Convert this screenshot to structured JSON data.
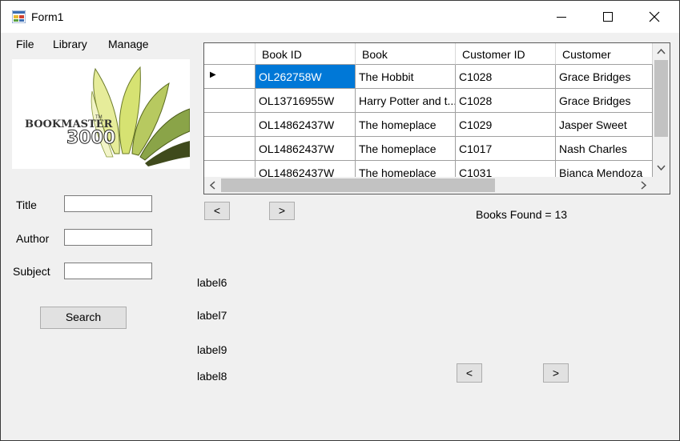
{
  "window": {
    "title": "Form1",
    "icon": "form-icon"
  },
  "titlebar_buttons": {
    "minimize": "minimize-icon",
    "maximize": "maximize-icon",
    "close": "close-icon"
  },
  "menu": [
    "File",
    "Library",
    "Manage"
  ],
  "logo": {
    "brand": "BOOKMASTER",
    "number": "3000",
    "tm": "TM"
  },
  "search": {
    "title_label": "Title",
    "author_label": "Author",
    "subject_label": "Subject",
    "title_value": "",
    "author_value": "",
    "subject_value": "",
    "button": "Search"
  },
  "grid": {
    "columns": [
      "Book ID",
      "Book",
      "Customer ID",
      "Customer"
    ],
    "rows": [
      [
        "OL262758W",
        "The Hobbit",
        "C1028",
        "Grace Bridges"
      ],
      [
        "OL13716955W",
        "Harry Potter and t...",
        "C1028",
        "Grace Bridges"
      ],
      [
        "OL14862437W",
        "The homeplace",
        "C1029",
        "Jasper Sweet"
      ],
      [
        "OL14862437W",
        "The homeplace",
        "C1017",
        "Nash Charles"
      ],
      [
        "OL14862437W",
        "The homeplace",
        "C1031",
        "Bianca Mendoza"
      ]
    ],
    "current_row_marker": "▶"
  },
  "pager": {
    "prev": "<",
    "next": ">"
  },
  "books_found": "Books Found = 13",
  "labels": {
    "label6": "label6",
    "label7": "label7",
    "label9": "label9",
    "label8": "label8"
  },
  "pager2": {
    "prev": "<",
    "next": ">"
  },
  "colors": {
    "selection": "#0078d7",
    "form_bg": "#f0f0f0"
  }
}
